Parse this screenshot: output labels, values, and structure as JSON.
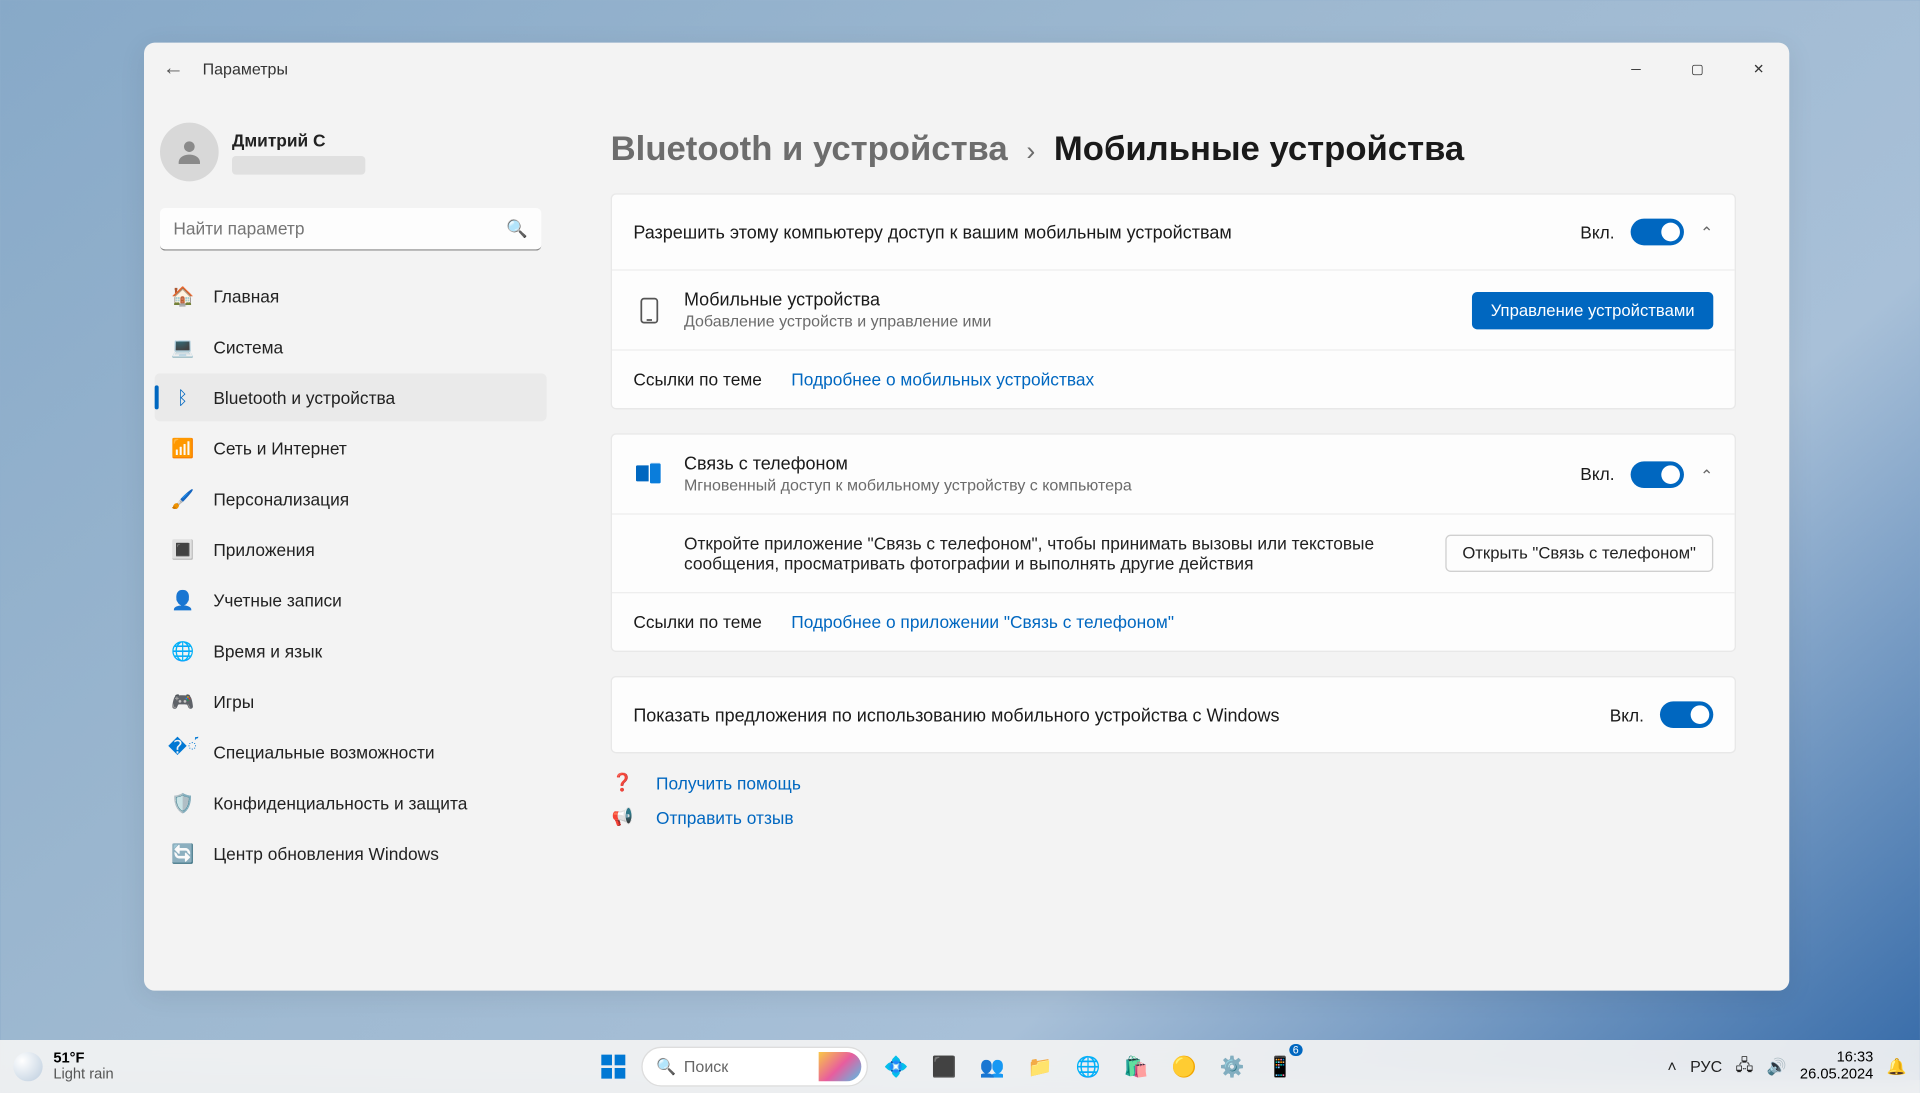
{
  "window": {
    "title": "Параметры"
  },
  "profile": {
    "name": "Дмитрий С"
  },
  "search": {
    "placeholder": "Найти параметр"
  },
  "sidebar": {
    "items": [
      {
        "label": "Главная"
      },
      {
        "label": "Система"
      },
      {
        "label": "Bluetooth и устройства"
      },
      {
        "label": "Сеть и Интернет"
      },
      {
        "label": "Персонализация"
      },
      {
        "label": "Приложения"
      },
      {
        "label": "Учетные записи"
      },
      {
        "label": "Время и язык"
      },
      {
        "label": "Игры"
      },
      {
        "label": "Специальные возможности"
      },
      {
        "label": "Конфиденциальность и защита"
      },
      {
        "label": "Центр обновления Windows"
      }
    ]
  },
  "breadcrumb": {
    "parent": "Bluetooth и устройства",
    "sep": "›",
    "current": "Мобильные устройства"
  },
  "sections": {
    "allow": {
      "title": "Разрешить этому компьютеру доступ к вашим мобильным устройствам",
      "on": "Вкл."
    },
    "mobile": {
      "title": "Мобильные устройства",
      "sub": "Добавление устройств и управление ими",
      "button": "Управление устройствами",
      "links_label": "Ссылки по теме",
      "link": "Подробнее о мобильных устройствах"
    },
    "phone": {
      "title": "Связь с телефоном",
      "sub": "Мгновенный доступ к мобильному устройству с компьютера",
      "on": "Вкл.",
      "desc": "Откройте приложение \"Связь с телефоном\", чтобы принимать вызовы или текстовые сообщения, просматривать фотографии и выполнять другие действия",
      "open_button": "Открыть \"Связь с телефоном\"",
      "links_label": "Ссылки по теме",
      "link": "Подробнее о приложении \"Связь с телефоном\""
    },
    "suggest": {
      "title": "Показать предложения по использованию мобильного устройства с Windows",
      "on": "Вкл."
    }
  },
  "footer": {
    "help": "Получить помощь",
    "feedback": "Отправить отзыв"
  },
  "taskbar": {
    "weather_temp": "51°F",
    "weather_desc": "Light rain",
    "search": "Поиск",
    "lang": "РУС",
    "time": "16:33",
    "date": "26.05.2024",
    "phone_badge": "6"
  }
}
